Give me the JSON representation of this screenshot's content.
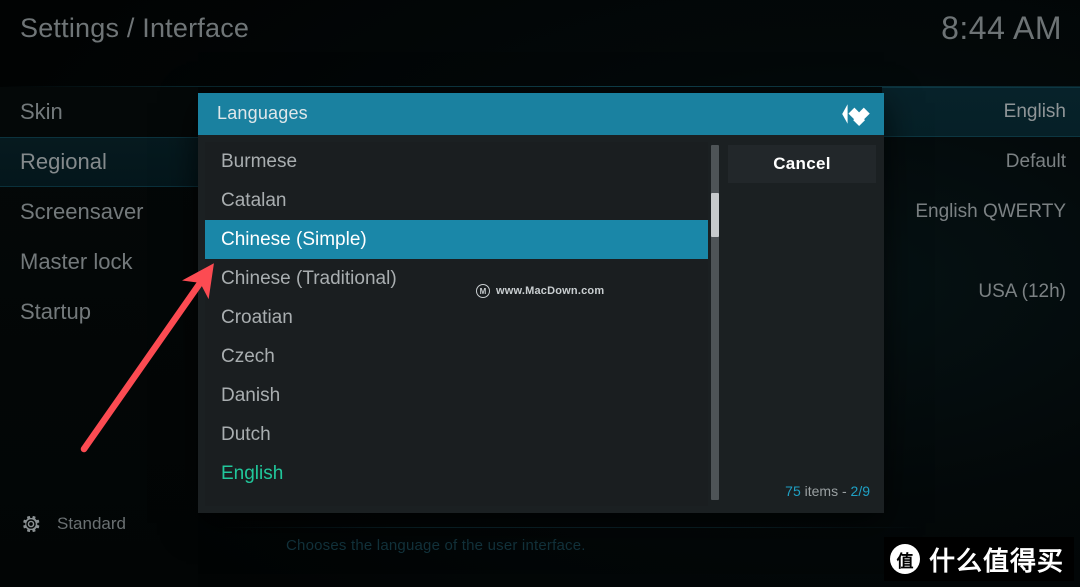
{
  "header": {
    "title": "Settings / Interface",
    "clock": "8:44 AM"
  },
  "sidebar": {
    "items": [
      {
        "label": "Skin",
        "selected": false
      },
      {
        "label": "Regional",
        "selected": true
      },
      {
        "label": "Screensaver",
        "selected": false
      },
      {
        "label": "Master lock",
        "selected": false
      },
      {
        "label": "Startup",
        "selected": false
      }
    ],
    "footer": {
      "icon": "gear-icon",
      "label": "Standard"
    }
  },
  "settings_values": [
    {
      "label": "English",
      "selected": true,
      "spaced": false
    },
    {
      "label": "Default",
      "selected": false,
      "spaced": false
    },
    {
      "label": "English QWERTY",
      "selected": false,
      "spaced": false
    },
    {
      "label": "USA (12h)",
      "selected": false,
      "spaced": true
    }
  ],
  "help": {
    "text": "Chooses the language of the user interface."
  },
  "dialog": {
    "title": "Languages",
    "logo": "kodi-logo",
    "cancel_label": "Cancel",
    "count_prefix": "75",
    "count_middle": " items - ",
    "count_page": "2/9",
    "items": [
      {
        "label": "Burmese",
        "selected": false,
        "current": false
      },
      {
        "label": "Catalan",
        "selected": false,
        "current": false
      },
      {
        "label": "Chinese (Simple)",
        "selected": true,
        "current": false
      },
      {
        "label": "Chinese (Traditional)",
        "selected": false,
        "current": false
      },
      {
        "label": "Croatian",
        "selected": false,
        "current": false
      },
      {
        "label": "Czech",
        "selected": false,
        "current": false
      },
      {
        "label": "Danish",
        "selected": false,
        "current": false
      },
      {
        "label": "Dutch",
        "selected": false,
        "current": false
      },
      {
        "label": "English",
        "selected": false,
        "current": true
      }
    ]
  },
  "macdown_watermark": {
    "glyph": "M",
    "text": "www.MacDown.com"
  },
  "site_watermark": {
    "badge": "值",
    "text": "什么值得买"
  },
  "annotation": {
    "type": "arrow",
    "color": "#fc4b52"
  },
  "colors": {
    "accent": "#1a87a8",
    "header_accent": "#1a81a0",
    "current_item": "#21c79b",
    "count_highlight": "#1fa0c4",
    "arrow": "#fc4b52"
  }
}
